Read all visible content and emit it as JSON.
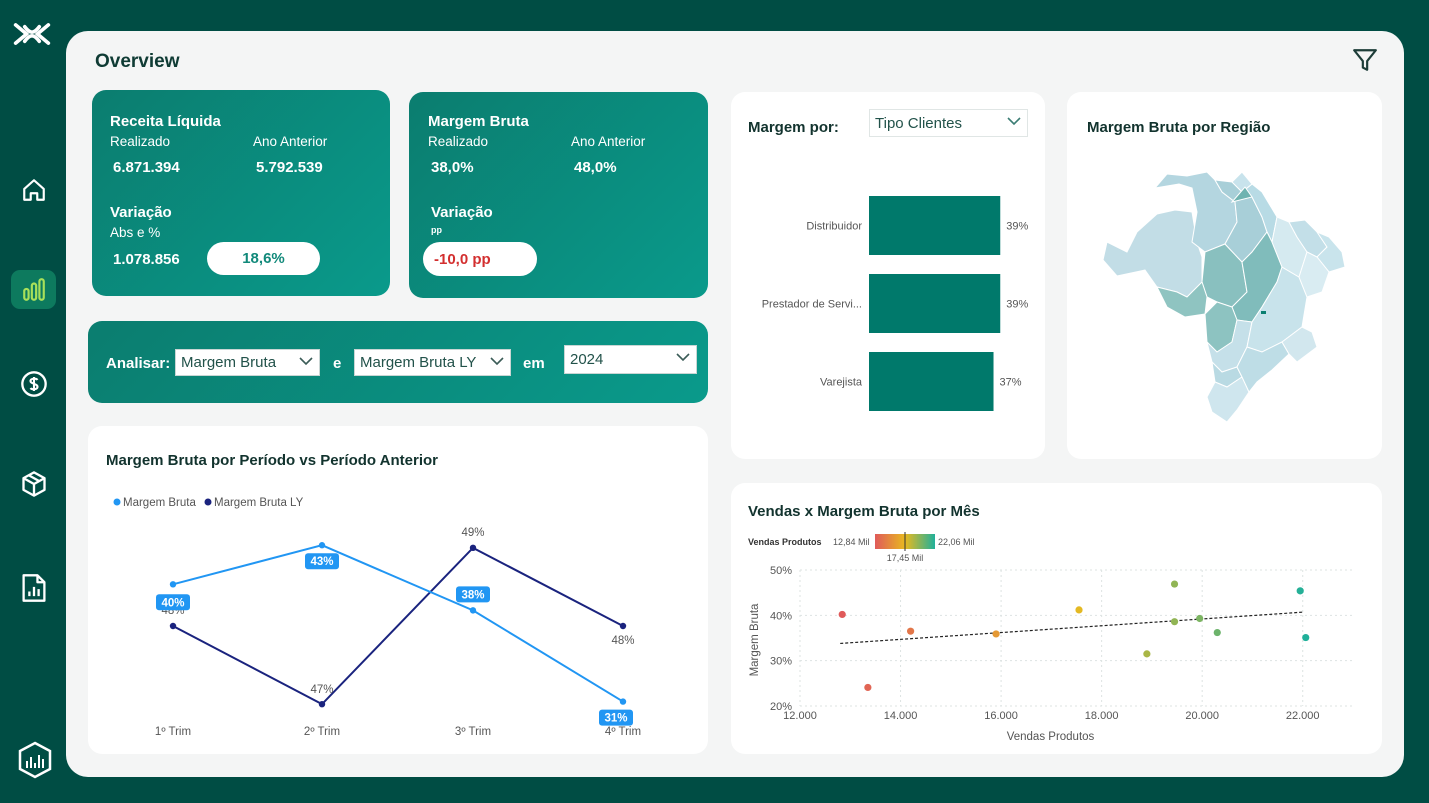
{
  "page": {
    "title": "Overview"
  },
  "sidebar": {
    "items": [
      {
        "icon": "logo-icon"
      },
      {
        "icon": "home-icon"
      },
      {
        "icon": "bar-chart-icon",
        "active": true
      },
      {
        "icon": "dollar-icon"
      },
      {
        "icon": "box-icon"
      },
      {
        "icon": "report-icon"
      },
      {
        "icon": "app-badge-icon"
      }
    ]
  },
  "kpi_receita": {
    "title": "Receita Líquida",
    "realizado_label": "Realizado",
    "ano_anterior_label": "Ano Anterior",
    "realizado_value": "6.871.394",
    "ano_anterior_value": "5.792.539",
    "variacao_label": "Variação",
    "variacao_sub": "Abs e %",
    "variacao_abs": "1.078.856",
    "variacao_pct": "18,6%"
  },
  "kpi_margem": {
    "title": "Margem Bruta",
    "realizado_label": "Realizado",
    "ano_anterior_label": "Ano Anterior",
    "realizado_value": "38,0%",
    "ano_anterior_value": "48,0%",
    "variacao_label": "Variação",
    "variacao_sub": "pp",
    "variacao_value": "-10,0 pp"
  },
  "analisar": {
    "label": "Analisar:",
    "select1": "Margem Bruta",
    "conj": "e",
    "select2": "Margem Bruta LY",
    "em": "em",
    "year": "2024"
  },
  "margem_por": {
    "label": "Margem por:",
    "select": "Tipo Clientes"
  },
  "map_card": {
    "title": "Margem Bruta por Região"
  },
  "colors": {
    "accent": "#00796b",
    "series1": "#2196f3",
    "series2": "#1a237e",
    "negative": "#d32f2f"
  },
  "chart_data": [
    {
      "type": "bar",
      "orientation": "horizontal",
      "categories": [
        "Distribuidor",
        "Prestador de Servi...",
        "Varejista"
      ],
      "values": [
        39,
        39,
        37
      ],
      "labels": [
        "39%",
        "39%",
        "37%"
      ],
      "xlim": [
        0,
        52
      ]
    },
    {
      "type": "line",
      "title": "Margem Bruta por Período vs Período Anterior",
      "categories": [
        "1º Trim",
        "2º Trim",
        "3º Trim",
        "4º Trim"
      ],
      "series": [
        {
          "name": "Margem Bruta",
          "values": [
            40,
            43,
            38,
            31
          ],
          "labels": [
            "40%",
            "43%",
            "38%",
            "31%"
          ]
        },
        {
          "name": "Margem Bruta LY",
          "values": [
            48,
            47,
            49,
            48
          ],
          "labels": [
            "48%",
            "47%",
            "49%",
            "48%"
          ]
        }
      ]
    },
    {
      "type": "scatter",
      "title": "Vendas x Margem Bruta por Mês",
      "xlabel": "Vendas Produtos",
      "ylabel": "Margem Bruta",
      "xlim": [
        12000,
        23000
      ],
      "ylim": [
        20,
        50
      ],
      "xticks": [
        "12.000",
        "14.000",
        "16.000",
        "18.000",
        "20.000",
        "22.000"
      ],
      "yticks": [
        "20%",
        "30%",
        "40%",
        "50%"
      ],
      "legend": {
        "title": "Vendas Produtos",
        "min": "12,84 Mil",
        "mid": "17,45 Mil",
        "max": "22,06 Mil"
      },
      "points": [
        {
          "x": 12840,
          "y": 40.2
        },
        {
          "x": 13350,
          "y": 24.1
        },
        {
          "x": 14200,
          "y": 36.5
        },
        {
          "x": 15900,
          "y": 35.9
        },
        {
          "x": 17550,
          "y": 41.2
        },
        {
          "x": 18900,
          "y": 31.5
        },
        {
          "x": 19450,
          "y": 46.9
        },
        {
          "x": 19450,
          "y": 38.6
        },
        {
          "x": 19950,
          "y": 39.3
        },
        {
          "x": 20300,
          "y": 36.2
        },
        {
          "x": 21950,
          "y": 45.4
        },
        {
          "x": 22060,
          "y": 35.1
        }
      ],
      "trendline": [
        [
          12800,
          33.8
        ],
        [
          22000,
          40.7
        ]
      ]
    }
  ]
}
